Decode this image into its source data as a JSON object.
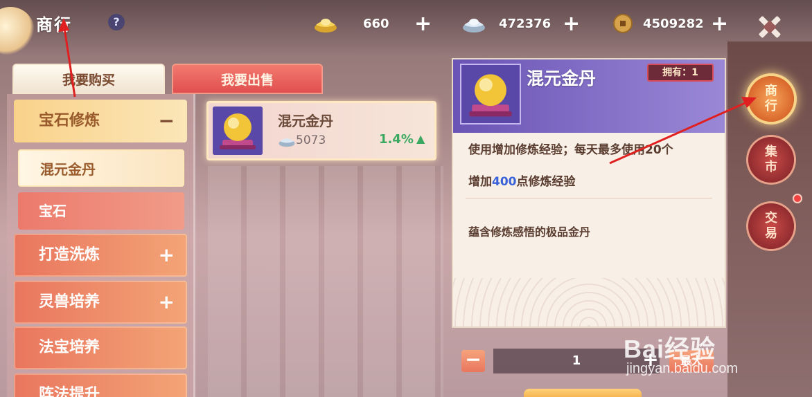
{
  "header": {
    "title": "商行",
    "help_label": "?",
    "currencies": [
      {
        "icon": "gold-ingot-icon",
        "value": "660",
        "add_label": "+"
      },
      {
        "icon": "silver-ingot-icon",
        "value": "472376",
        "add_label": "+"
      },
      {
        "icon": "copper-coin-icon",
        "value": "4509282",
        "add_label": "+"
      }
    ]
  },
  "tabs": [
    {
      "label": "我要购买",
      "active": true
    },
    {
      "label": "我要出售",
      "active": false
    }
  ],
  "categories": [
    {
      "label": "宝石修炼",
      "sign": "−",
      "expanded": true,
      "children": [
        {
          "label": "混元金丹",
          "selected": true
        },
        {
          "label": "宝石",
          "selected": false
        }
      ]
    },
    {
      "label": "打造洗炼",
      "sign": "+"
    },
    {
      "label": "灵兽培养",
      "sign": "+"
    },
    {
      "label": "法宝培养",
      "sign": ""
    },
    {
      "label": "阵法提升",
      "sign": ""
    }
  ],
  "items": [
    {
      "name": "混元金丹",
      "price": "5073",
      "change": "1.4%",
      "trend": "up"
    }
  ],
  "detail": {
    "name": "混元金丹",
    "owned": "拥有：1",
    "desc_line1": "使用增加修炼经验；每天最多使用20个",
    "desc_line2_prefix": "增加",
    "desc_line2_number": "400",
    "desc_line2_suffix": "点修炼经验",
    "flavor": "蕴含修炼感悟的极品金丹"
  },
  "quantity": {
    "minus": "−",
    "value": "1",
    "plus": "+",
    "max_label": "最大"
  },
  "side_nav": [
    {
      "label": "商行",
      "active": true
    },
    {
      "label": "集市",
      "active": false
    },
    {
      "label": "交易",
      "active": false
    }
  ],
  "watermark": {
    "logo": "Bai经验",
    "url": "jingyan.baidu.com"
  },
  "colors": {
    "accent": "#e9765e",
    "gold": "#f9d28a",
    "rise": "#3aa860",
    "annotation": "#e02020"
  }
}
